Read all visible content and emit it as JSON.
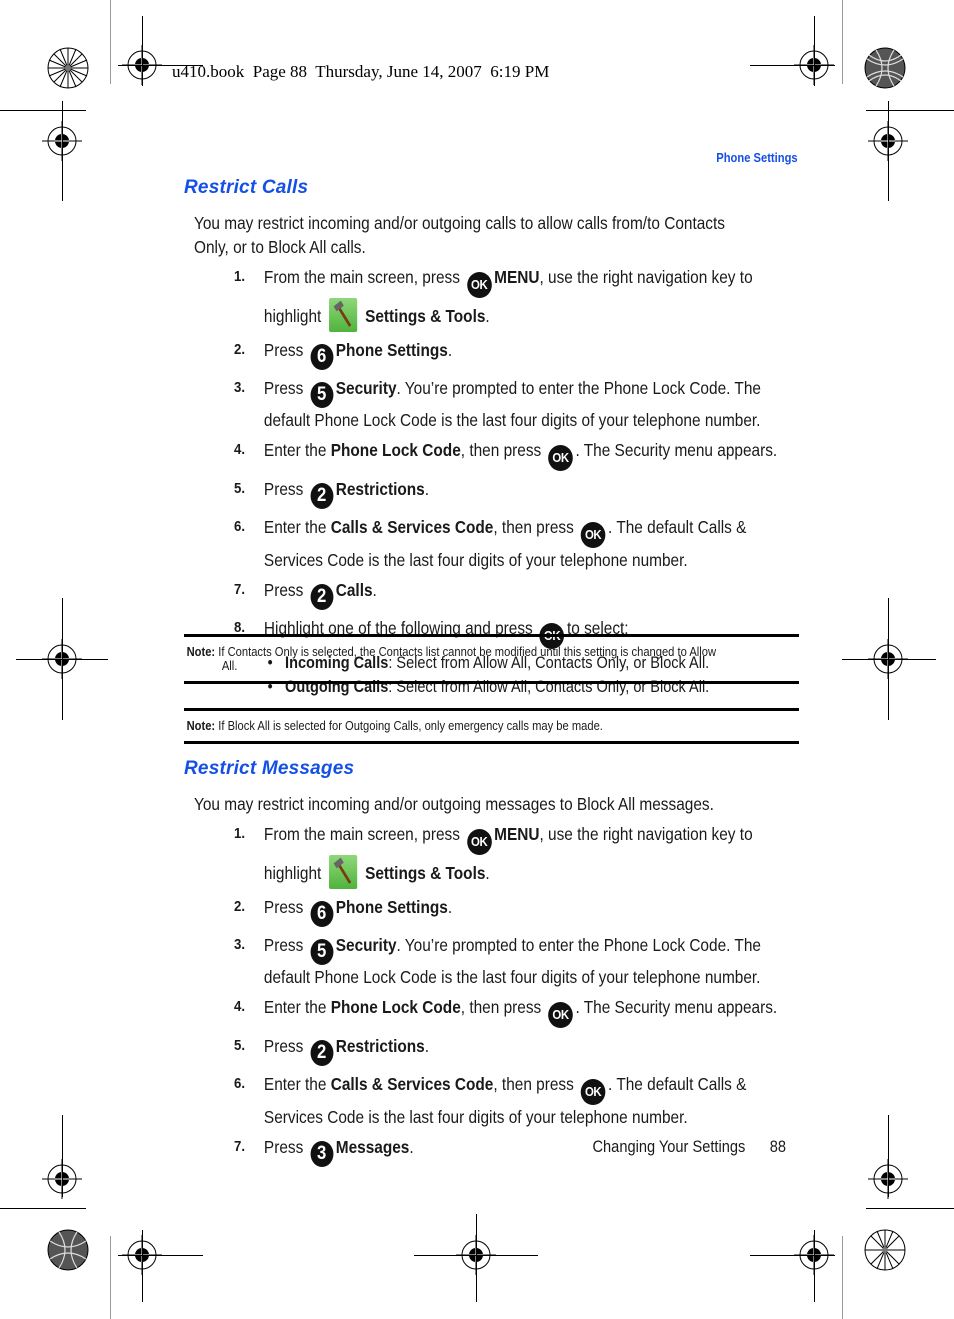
{
  "print_header": {
    "file": "u410.book",
    "page": "Page 88",
    "date": "Thursday, June 14, 2007",
    "time": "6:19 PM"
  },
  "running_head": "Phone Settings",
  "sections": [
    {
      "title": "Restrict Calls",
      "intro": "You may restrict incoming and/or outgoing calls to allow calls from/to Contacts Only, or to Block All calls.",
      "steps": [
        {
          "num": "1.",
          "pre": "From the main screen, press",
          "key": "OK",
          "bold": "MENU",
          "post": ", use the right navigation key to highlight",
          "icon": "settings-tools-icon",
          "bold2": "Settings & Tools",
          "post2": "."
        },
        {
          "num": "2.",
          "pre": "Press",
          "key": "6",
          "bold": "Phone Settings",
          "post": "."
        },
        {
          "num": "3.",
          "pre": "Press",
          "key": "5",
          "bold": "Security",
          "post": ". You’re prompted to enter the Phone Lock Code. The default Phone Lock Code is the last four digits of your telephone number."
        },
        {
          "num": "4.",
          "pre": "Enter the",
          "bold": "Phone Lock Code",
          "mid": ", then press",
          "key": "OK",
          "post": ". The Security menu appears."
        },
        {
          "num": "5.",
          "pre": "Press",
          "key": "2",
          "bold": "Restrictions",
          "post": "."
        },
        {
          "num": "6.",
          "pre": "Enter the",
          "bold": "Calls & Services Code",
          "mid": ", then press",
          "key": "OK",
          "post": ". The default Calls & Services Code is the last four digits of your telephone number."
        },
        {
          "num": "7.",
          "pre": "Press",
          "key": "2",
          "bold": "Calls",
          "post": "."
        },
        {
          "num": "8.",
          "pre": "Highlight one of the following and press",
          "key": "OK",
          "post": "to select:"
        }
      ],
      "bullets": [
        {
          "bold": "Incoming Calls",
          "text": ": Select from Allow All, Contacts Only, or Block All."
        },
        {
          "bold": "Outgoing Calls",
          "text": ": Select from Allow All, Contacts Only, or Block All."
        }
      ],
      "notes": [
        {
          "label": "Note:",
          "text": "If Contacts Only is selected, the Contacts list cannot be modified until this setting is changed to Allow",
          "cont": "All."
        },
        {
          "label": "Note:",
          "text": "If Block All is selected for Outgoing Calls, only emergency calls may be made."
        }
      ]
    },
    {
      "title": "Restrict Messages",
      "intro": "You may restrict incoming and/or outgoing messages to Block All messages.",
      "steps": [
        {
          "num": "1.",
          "pre": "From the main screen, press",
          "key": "OK",
          "bold": "MENU",
          "post": ", use the right navigation key to highlight",
          "icon": "settings-tools-icon",
          "bold2": "Settings & Tools",
          "post2": "."
        },
        {
          "num": "2.",
          "pre": "Press",
          "key": "6",
          "bold": "Phone Settings",
          "post": "."
        },
        {
          "num": "3.",
          "pre": "Press",
          "key": "5",
          "bold": "Security",
          "post": ". You’re prompted to enter the Phone Lock Code. The default Phone Lock Code is the last four digits of your telephone number."
        },
        {
          "num": "4.",
          "pre": "Enter the",
          "bold": "Phone Lock Code",
          "mid": ", then press",
          "key": "OK",
          "post": ". The Security menu appears."
        },
        {
          "num": "5.",
          "pre": "Press",
          "key": "2",
          "bold": "Restrictions",
          "post": "."
        },
        {
          "num": "6.",
          "pre": "Enter the",
          "bold": "Calls & Services Code",
          "mid": ", then press",
          "key": "OK",
          "post": ". The default Calls & Services Code is the last four digits of your telephone number."
        },
        {
          "num": "7.",
          "pre": "Press",
          "key": "3",
          "bold": "Messages",
          "post": "."
        }
      ]
    }
  ],
  "footer": {
    "chapter": "Changing Your Settings",
    "page_number": "88"
  }
}
